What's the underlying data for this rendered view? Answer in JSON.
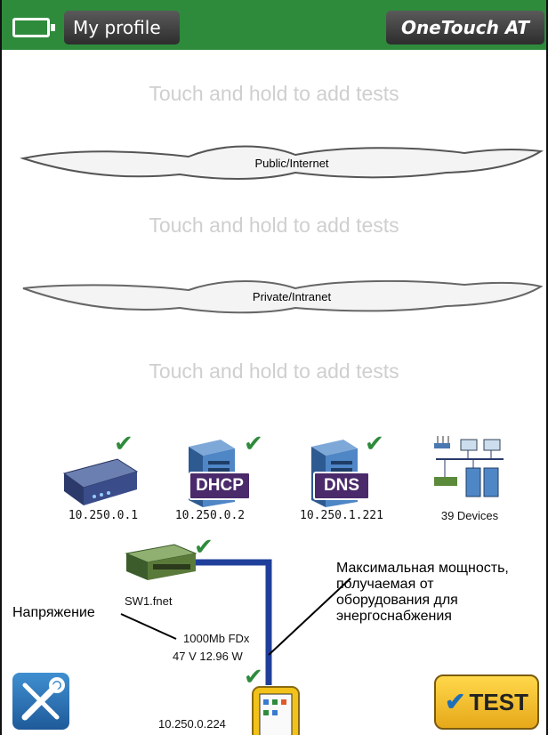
{
  "header": {
    "profile_label": "My profile",
    "brand_label": "OneTouch AT"
  },
  "hints": {
    "top": "Touch and hold to add tests",
    "middle": "Touch and hold to add tests",
    "bottom": "Touch and hold to add tests"
  },
  "clouds": {
    "public": "Public/Internet",
    "private": "Private/Intranet"
  },
  "devices": [
    {
      "ip": "10.250.0.1",
      "icon": "router-icon"
    },
    {
      "ip": "10.250.0.2",
      "icon": "dhcp-server-icon",
      "label": "DHCP"
    },
    {
      "ip": "10.250.1.221",
      "icon": "dns-server-icon",
      "label": "DNS"
    },
    {
      "ip": "39 Devices",
      "icon": "network-devices-icon"
    }
  ],
  "switch": {
    "name": "SW1.fnet",
    "link": "1000Mb FDx",
    "power": "47 V 12.96 W"
  },
  "tester": {
    "ip": "10.250.0.224"
  },
  "annotations": {
    "voltage": "Напряжение",
    "power_lines": [
      "Максимальная мощность,",
      "получаемая от",
      "оборудования для",
      "энергоснабжения"
    ]
  },
  "buttons": {
    "test_label": "TEST"
  },
  "colors": {
    "topbar": "#2e8b3c",
    "check": "#2e8b3c",
    "link": "#1f3f9a",
    "test_button": "#f5c22e"
  }
}
